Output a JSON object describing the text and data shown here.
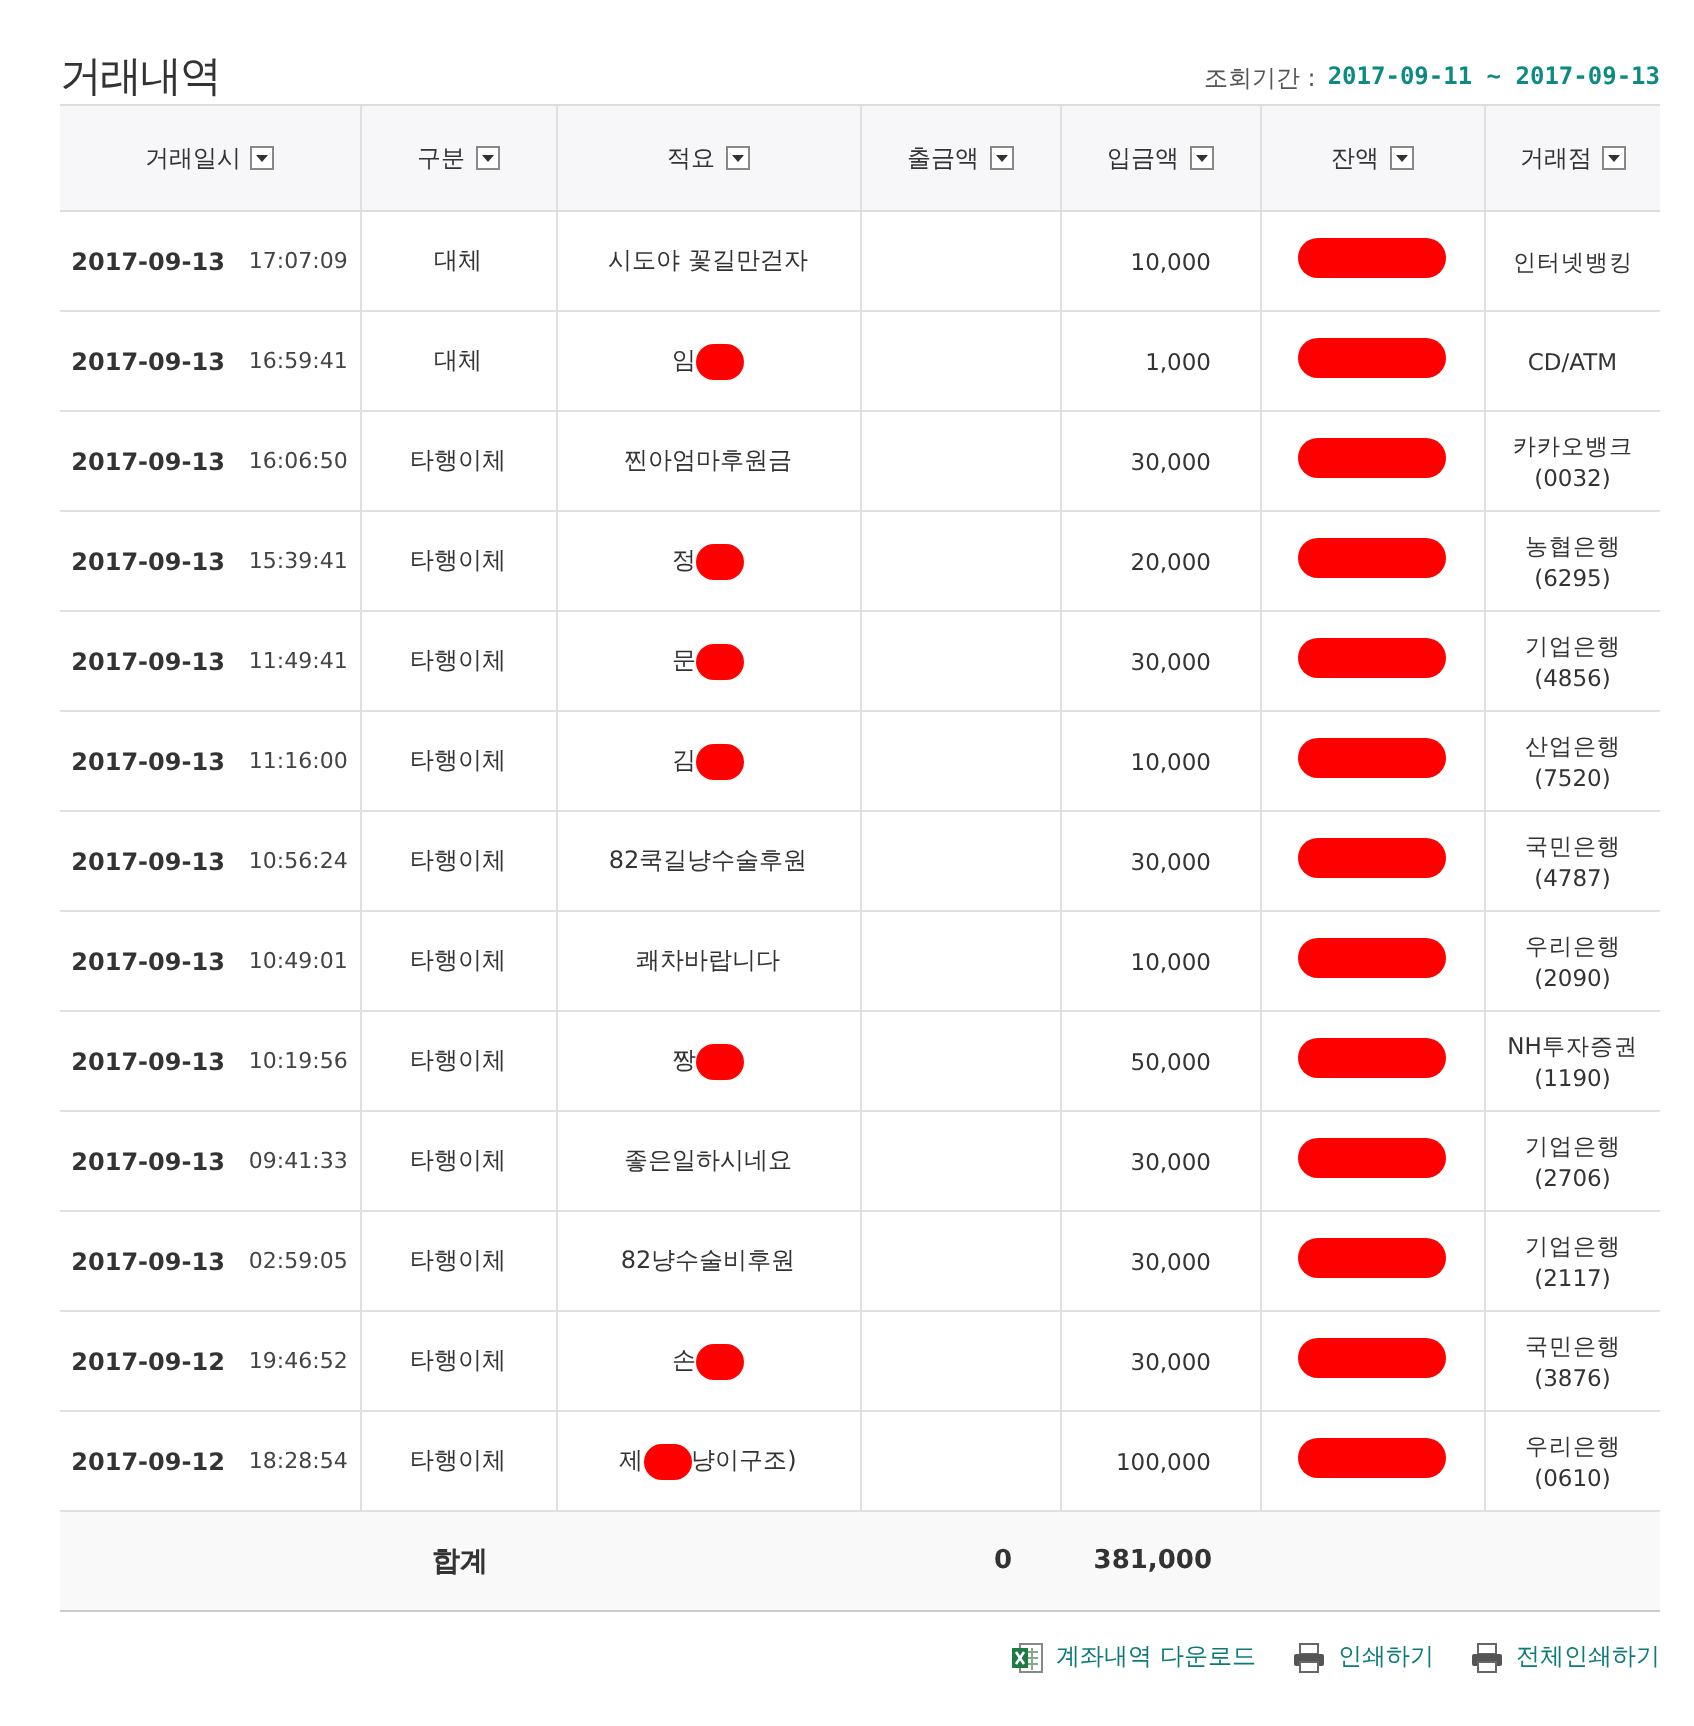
{
  "title": "거래내역",
  "period": {
    "label": "조회기간 :",
    "value": "2017-09-11 ~ 2017-09-13"
  },
  "columns": [
    "거래일시",
    "구분",
    "적요",
    "출금액",
    "입금액",
    "잔액",
    "거래점"
  ],
  "rows": [
    {
      "date": "2017-09-13",
      "time": "17:07:09",
      "type": "대체",
      "memo": "시도야 꽃길만걷자",
      "memo_redacted": false,
      "withdrawal": "",
      "deposit": "10,000",
      "balance_redacted": true,
      "branch": "인터넷뱅킹"
    },
    {
      "date": "2017-09-13",
      "time": "16:59:41",
      "type": "대체",
      "memo": "임",
      "memo_redacted": true,
      "withdrawal": "",
      "deposit": "1,000",
      "balance_redacted": true,
      "branch": "CD/ATM"
    },
    {
      "date": "2017-09-13",
      "time": "16:06:50",
      "type": "타행이체",
      "memo": "찐아엄마후원금",
      "memo_redacted": false,
      "withdrawal": "",
      "deposit": "30,000",
      "balance_redacted": true,
      "branch": "카카오뱅크",
      "branch_code": "(0032)"
    },
    {
      "date": "2017-09-13",
      "time": "15:39:41",
      "type": "타행이체",
      "memo": "정",
      "memo_redacted": true,
      "withdrawal": "",
      "deposit": "20,000",
      "balance_redacted": true,
      "branch": "농협은행",
      "branch_code": "(6295)"
    },
    {
      "date": "2017-09-13",
      "time": "11:49:41",
      "type": "타행이체",
      "memo": "문",
      "memo_redacted": true,
      "withdrawal": "",
      "deposit": "30,000",
      "balance_redacted": true,
      "branch": "기업은행",
      "branch_code": "(4856)"
    },
    {
      "date": "2017-09-13",
      "time": "11:16:00",
      "type": "타행이체",
      "memo": "김",
      "memo_redacted": true,
      "withdrawal": "",
      "deposit": "10,000",
      "balance_redacted": true,
      "branch": "산업은행",
      "branch_code": "(7520)"
    },
    {
      "date": "2017-09-13",
      "time": "10:56:24",
      "type": "타행이체",
      "memo": "82쿡길냥수술후원",
      "memo_redacted": false,
      "withdrawal": "",
      "deposit": "30,000",
      "balance_redacted": true,
      "branch": "국민은행",
      "branch_code": "(4787)"
    },
    {
      "date": "2017-09-13",
      "time": "10:49:01",
      "type": "타행이체",
      "memo": "쾌차바랍니다",
      "memo_redacted": false,
      "withdrawal": "",
      "deposit": "10,000",
      "balance_redacted": true,
      "branch": "우리은행",
      "branch_code": "(2090)"
    },
    {
      "date": "2017-09-13",
      "time": "10:19:56",
      "type": "타행이체",
      "memo": "짱",
      "memo_redacted": true,
      "withdrawal": "",
      "deposit": "50,000",
      "balance_redacted": true,
      "branch": "NH투자증권",
      "branch_code": "(1190)"
    },
    {
      "date": "2017-09-13",
      "time": "09:41:33",
      "type": "타행이체",
      "memo": "좋은일하시네요",
      "memo_redacted": false,
      "withdrawal": "",
      "deposit": "30,000",
      "balance_redacted": true,
      "branch": "기업은행",
      "branch_code": "(2706)"
    },
    {
      "date": "2017-09-13",
      "time": "02:59:05",
      "type": "타행이체",
      "memo": "82냥수술비후원",
      "memo_redacted": false,
      "withdrawal": "",
      "deposit": "30,000",
      "balance_redacted": true,
      "branch": "기업은행",
      "branch_code": "(2117)"
    },
    {
      "date": "2017-09-12",
      "time": "19:46:52",
      "type": "타행이체",
      "memo": "손",
      "memo_redacted": true,
      "withdrawal": "",
      "deposit": "30,000",
      "balance_redacted": true,
      "branch": "국민은행",
      "branch_code": "(3876)"
    },
    {
      "date": "2017-09-12",
      "time": "18:28:54",
      "type": "타행이체",
      "memo": "제",
      "memo_redacted": true,
      "memo_tail": "냥이구조)",
      "withdrawal": "",
      "deposit": "100,000",
      "balance_redacted": true,
      "branch": "우리은행",
      "branch_code": "(0610)"
    }
  ],
  "total": {
    "label": "합계",
    "withdrawal": "0",
    "deposit": "381,000"
  },
  "actions": [
    {
      "kind": "excel",
      "label": "계좌내역 다운로드"
    },
    {
      "kind": "print",
      "label": "인쇄하기"
    },
    {
      "kind": "print",
      "label": "전체인쇄하기"
    }
  ]
}
